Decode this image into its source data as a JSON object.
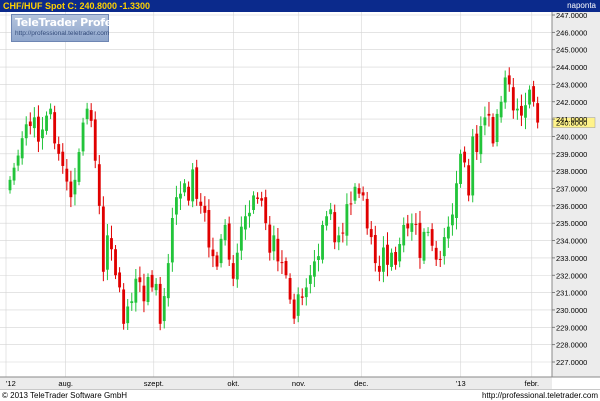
{
  "header": {
    "symbol_text": "CHF/HUF Spot C: 240.8000 -1.3300",
    "period_label": "naponta"
  },
  "watermark": {
    "title": "TeleTrader Professional",
    "url": "http://professional.teletrader.com"
  },
  "footer": {
    "copyright": "© 2013 TeleTrader Software GmbH",
    "url": "http://professional.teletrader.com"
  },
  "colors": {
    "up": "#22c43a",
    "down": "#e00000",
    "header_bg": "#0b2a8c",
    "grid": "#d4d4d4",
    "axis_bg": "#ececec",
    "price_tag_bg": "#fff38a"
  },
  "chart_data": {
    "type": "candlestick",
    "title": "CHF/HUF Spot",
    "last_price": 240.8,
    "change": -1.33,
    "ylim": [
      226.5,
      247.5
    ],
    "y_ticks": [
      "227.0000",
      "228.0000",
      "229.0000",
      "230.0000",
      "231.0000",
      "232.0000",
      "233.0000",
      "234.0000",
      "235.0000",
      "236.0000",
      "237.0000",
      "238.0000",
      "239.0000",
      "240.0000",
      "240.8000",
      "241.0000",
      "242.0000",
      "243.0000",
      "244.0000",
      "245.0000",
      "246.0000",
      "247.0000"
    ],
    "x_labels": [
      "'12",
      "aug.",
      "szept.",
      "okt.",
      "nov.",
      "dec.",
      "'13",
      "febr."
    ],
    "x_label_positions_days": [
      0,
      21,
      52,
      80,
      103,
      125,
      160,
      185
    ],
    "grid": true,
    "closes": [
      237.5,
      238.2,
      238.9,
      239.9,
      240.7,
      240.6,
      241.1,
      239.7,
      240.4,
      241.2,
      241.6,
      239.6,
      239.0,
      238.3,
      237.4,
      236.5,
      237.5,
      239.1,
      240.8,
      241.6,
      240.9,
      238.6,
      236.0,
      232.2,
      234.3,
      233.5,
      232.0,
      231.3,
      229.2,
      230.2,
      230.5,
      231.8,
      231.6,
      230.5,
      231.9,
      231.3,
      231.5,
      229.2,
      230.8,
      232.7,
      235.3,
      236.5,
      236.7,
      237.3,
      236.3,
      238.1,
      236.4,
      236.0,
      235.6,
      233.6,
      233.1,
      232.5,
      234.1,
      234.9,
      232.9,
      231.8,
      233.3,
      234.8,
      235.4,
      235.6,
      236.6,
      236.4,
      236.3,
      235.0,
      233.3,
      234.3,
      232.8,
      232.7,
      232.0,
      230.6,
      229.5,
      230.9,
      230.7,
      231.3,
      232.0,
      232.8,
      233.1,
      234.9,
      235.4,
      235.8,
      233.9,
      234.3,
      234.4,
      236.1,
      236.1,
      237.1,
      236.7,
      236.6,
      234.7,
      234.2,
      232.7,
      232.2,
      233.6,
      232.6,
      233.3,
      232.6,
      233.8,
      234.9,
      234.7,
      235.0,
      234.9,
      233.0,
      234.5,
      234.5,
      233.7,
      232.9,
      232.9,
      234.2,
      234.8,
      235.5,
      237.3,
      239.0,
      238.5,
      236.6,
      240.0,
      239.1,
      240.6,
      241.1,
      241.2,
      239.6,
      241.3,
      242.0,
      243.4,
      243.0,
      241.5,
      241.6,
      241.2,
      241.8,
      242.7,
      242.0,
      240.8
    ],
    "x_axis_days_total": 190
  }
}
